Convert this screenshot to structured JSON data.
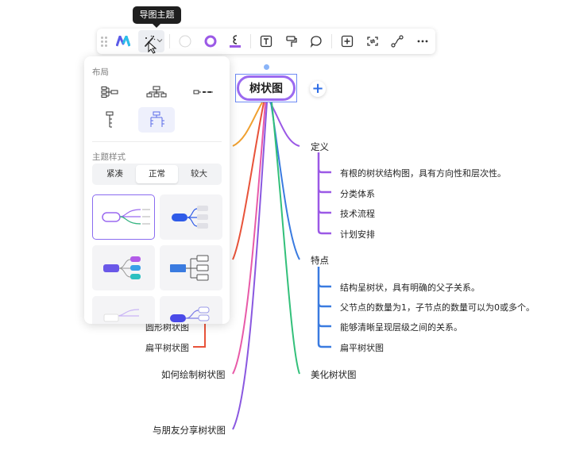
{
  "tooltip": {
    "text": "导图主题"
  },
  "toolbar": {
    "items": [
      "theme-logo",
      "mindmap-theme",
      "node-fill",
      "node-border",
      "line-color",
      "text-style",
      "format-painter",
      "callout",
      "insert-node",
      "convert",
      "relation",
      "more"
    ]
  },
  "panel": {
    "layout_title": "布局",
    "style_title": "主题样式",
    "size_options": [
      "紧凑",
      "正常",
      "较大"
    ],
    "active_size": "正常"
  },
  "mindmap": {
    "root": "树状图",
    "branches": [
      {
        "label": "定义",
        "color": "#9b59e6",
        "children": [
          "有根的树状结构图，具有方向性和层次性。",
          "分类体系",
          "技术流程",
          "计划安排"
        ]
      },
      {
        "label": "特点",
        "color": "#3a7be0",
        "children": [
          "结构呈树状，具有明确的父子关系。",
          "父节点的数量为1，子节点的数量可以为0或多个。",
          "能够清晰呈现层级之间的关系。",
          "扁平树状图"
        ]
      },
      {
        "label": "美化树状图",
        "color": "#33c07a"
      }
    ],
    "left_children": [
      {
        "label": "圆形树状图",
        "color": "#e8533a"
      },
      {
        "label": "扁平树状图",
        "color": "#e8533a"
      }
    ],
    "left_branches": [
      {
        "label": "如何绘制树状图",
        "color": "#e85aa8"
      },
      {
        "label": "与朋友分享树状图",
        "color": "#8a58e0"
      }
    ]
  },
  "colors": {
    "accent": "#8a6cf0",
    "root_border": "#9b6af0",
    "orange": "#f0a030",
    "red": "#e8533a",
    "pink": "#e85aa8",
    "violet": "#8a58e0",
    "purple": "#9b59e6",
    "blue": "#3a7be0",
    "green": "#33c07a"
  }
}
